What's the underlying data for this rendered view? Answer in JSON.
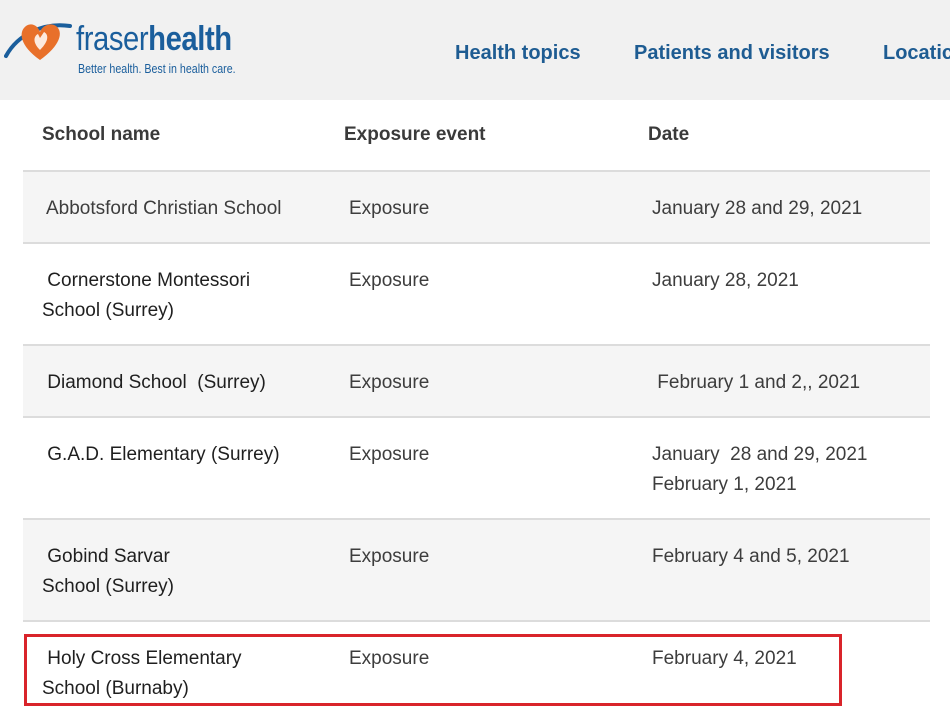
{
  "header": {
    "logo": {
      "brand_part1": "fraser",
      "brand_part2": "health",
      "tagline": "Better health. Best in health care."
    },
    "nav": [
      {
        "label": "Health topics"
      },
      {
        "label": "Patients and visitors"
      },
      {
        "label": "Locatic"
      }
    ]
  },
  "table": {
    "columns": [
      "School name",
      "Exposure event",
      "Date"
    ],
    "rows": [
      {
        "school": "Abbotsford Christian School",
        "event": "Exposure",
        "date": "January 28 and 29, 2021"
      },
      {
        "school": " Cornerstone Montessori\nSchool (Surrey)",
        "event": "Exposure",
        "date": "January 28, 2021"
      },
      {
        "school": " Diamond School  (Surrey)",
        "event": "Exposure",
        "date": " February 1 and 2,, 2021"
      },
      {
        "school": " G.A.D. Elementary (Surrey)",
        "event": "Exposure",
        "date": "January  28 and 29, 2021\nFebruary 1, 2021"
      },
      {
        "school": " Gobind Sarvar\nSchool (Surrey)",
        "event": "Exposure",
        "date": "February 4 and 5, 2021"
      },
      {
        "school": " Holy Cross Elementary\nSchool (Burnaby)",
        "event": "Exposure",
        "date": "February 4, 2021"
      }
    ]
  },
  "colors": {
    "brand_blue": "#1a5e9c",
    "brand_orange": "#e8702a",
    "highlight_red": "#d9242a"
  }
}
